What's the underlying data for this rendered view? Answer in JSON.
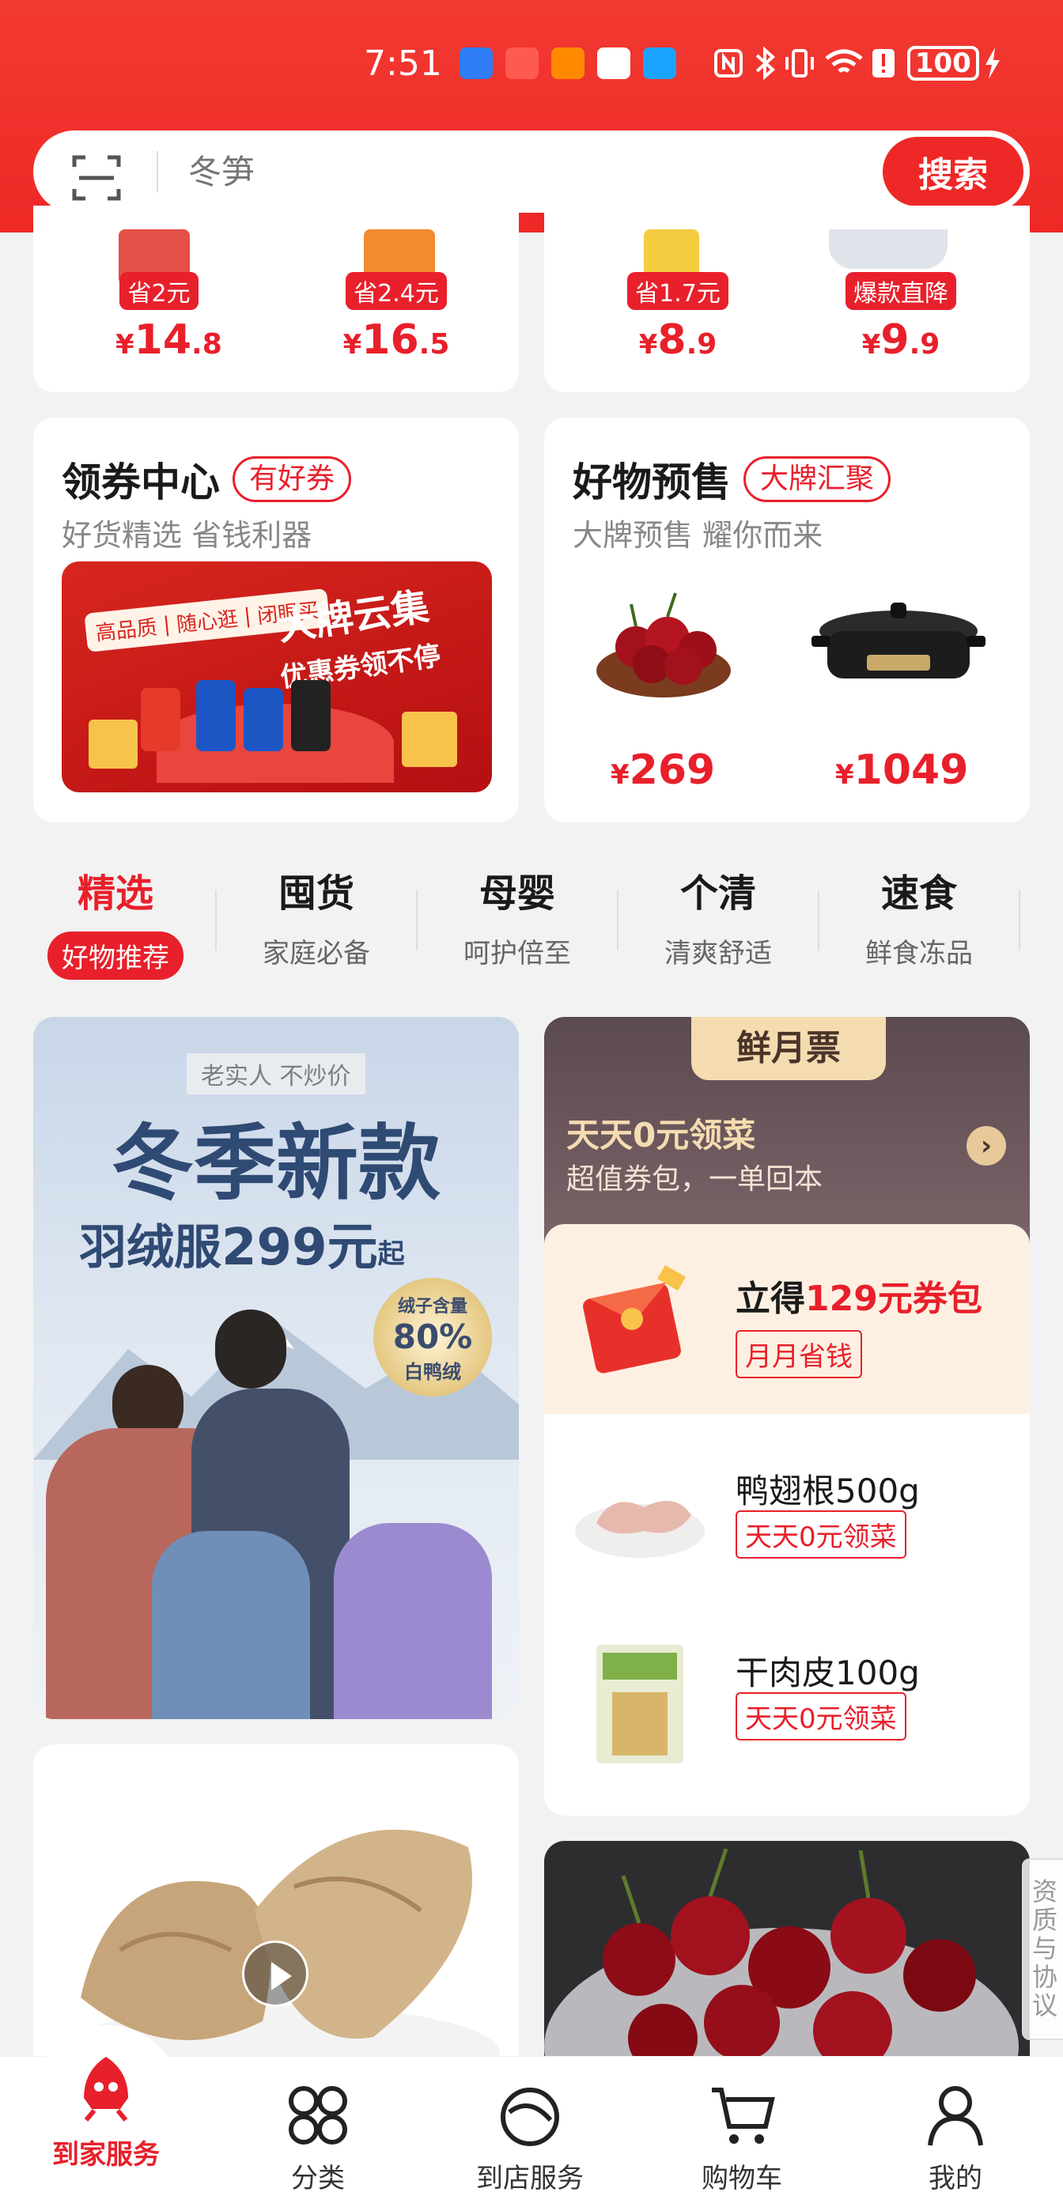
{
  "status": {
    "time": "7:51",
    "battery": "100"
  },
  "search": {
    "placeholder": "冬笋",
    "button": "搜索"
  },
  "deals_left": [
    {
      "badge": "省2元",
      "price_int": "14",
      "price_dec": ".8"
    },
    {
      "badge": "省2.4元",
      "price_int": "16",
      "price_dec": ".5"
    }
  ],
  "deals_right": [
    {
      "badge": "省1.7元",
      "price_int": "8",
      "price_dec": ".9"
    },
    {
      "badge": "爆款直降",
      "price_int": "9",
      "price_dec": ".9"
    }
  ],
  "coupon_center": {
    "title": "领券中心",
    "tag": "有好券",
    "subtitle": "好货精选 省钱利器",
    "banner_chips": [
      "高品质",
      "随心逛",
      "闭眼买"
    ],
    "banner_title_1": "大牌云集",
    "banner_title_2": "优惠券领不停"
  },
  "presale": {
    "title": "好物预售",
    "tag": "大牌汇聚",
    "subtitle": "大牌预售 耀你而来",
    "items": [
      {
        "price": "269"
      },
      {
        "price": "1049"
      }
    ]
  },
  "categories": [
    {
      "title": "精选",
      "sub": "好物推荐",
      "active": true
    },
    {
      "title": "囤货",
      "sub": "家庭必备"
    },
    {
      "title": "母婴",
      "sub": "呵护倍至"
    },
    {
      "title": "个清",
      "sub": "清爽舒适"
    },
    {
      "title": "速食",
      "sub": "鲜食冻品"
    }
  ],
  "promo_down": {
    "tag": "老实人 不炒价",
    "headline": "冬季新款",
    "subline_a": "羽绒服",
    "subline_price": "299元",
    "subline_b": "起",
    "seal_1": "绒子含量",
    "seal_2": "80%",
    "seal_3": "白鸭绒"
  },
  "monthly": {
    "badge": "鲜月票",
    "title": "天天0元领菜",
    "subtitle": "超值券包，一单回本",
    "offer_prefix": "立得",
    "offer_amount": "129元券包",
    "offer_tag": "月月省钱",
    "items": [
      {
        "name": "鸭翅根500g",
        "tag": "天天0元领菜"
      },
      {
        "name": "干肉皮100g",
        "tag": "天天0元领菜"
      }
    ]
  },
  "side_tab": {
    "label": "资质与协议"
  },
  "bottom_nav": [
    {
      "label": "到家服务",
      "active": true
    },
    {
      "label": "分类"
    },
    {
      "label": "到店服务"
    },
    {
      "label": "购物车"
    },
    {
      "label": "我的"
    }
  ],
  "colors": {
    "brand": "#ee2826",
    "price": "#e8202b",
    "gold": "#f5dcb0"
  }
}
